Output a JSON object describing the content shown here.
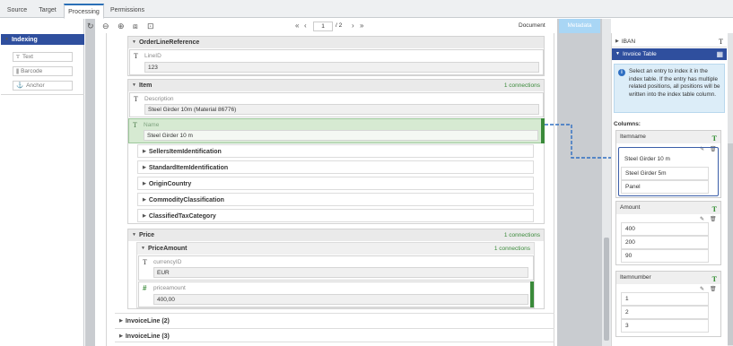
{
  "tabs": [
    {
      "label": "Source"
    },
    {
      "label": "Target"
    },
    {
      "label": "Processing"
    },
    {
      "label": "Permissions"
    }
  ],
  "left": {
    "indexing_label": "Indexing",
    "palette": [
      {
        "label": "Text",
        "icon": "text-icon"
      },
      {
        "label": "Barcode",
        "icon": "barcode-icon"
      },
      {
        "label": "Anchor",
        "icon": "anchor-icon"
      }
    ]
  },
  "toolbar": {
    "page_current": "1",
    "page_total": "/ 2",
    "document_label": "Document",
    "metadata_label": "Metadata"
  },
  "doc": {
    "order_line_reference": "OrderLineReference",
    "line_id_label": "LineID",
    "line_id_value": "123",
    "item": "Item",
    "item_connections": "1 connections",
    "description_label": "Description",
    "description_value": "Steel Girder 10m (Material 86776)",
    "name_label": "Name",
    "name_value": "Steel Girder 10 m",
    "subsections": [
      "SellersItemIdentification",
      "StandardItemIdentification",
      "OriginCountry",
      "CommodityClassification",
      "ClassifiedTaxCategory"
    ],
    "price": "Price",
    "price_connections": "1 connections",
    "price_amount": "PriceAmount",
    "price_amount_connections": "1 connections",
    "currency_label": "currencyID",
    "currency_value": "EUR",
    "priceamount_label": "priceamount",
    "priceamount_value": "400,00",
    "invoice_line_2": "InvoiceLine (2)",
    "invoice_line_3": "InvoiceLine (3)"
  },
  "right": {
    "iban_label": "IBAN",
    "invoice_table_label": "Invoice Table",
    "info_text": "Select an entry to index it in the index table. If the entry has multiple related positions, all positions will be written into the index table column.",
    "columns_label": "Columns:",
    "columns": [
      {
        "name": "Itemname",
        "values": [
          "Steel Girder 10 m",
          "Steel Girder 5m",
          "Panel"
        ]
      },
      {
        "name": "Amount",
        "values": [
          "400",
          "200",
          "90"
        ]
      },
      {
        "name": "Itemnumber",
        "values": [
          "1",
          "2",
          "3"
        ]
      }
    ]
  },
  "colors": {
    "accent": "#2f4f9e",
    "connection": "#3a8a3a",
    "highlight": "#d6ead2",
    "metadata_tab": "#a9d6f5",
    "arrow": "#2f6fc2"
  }
}
